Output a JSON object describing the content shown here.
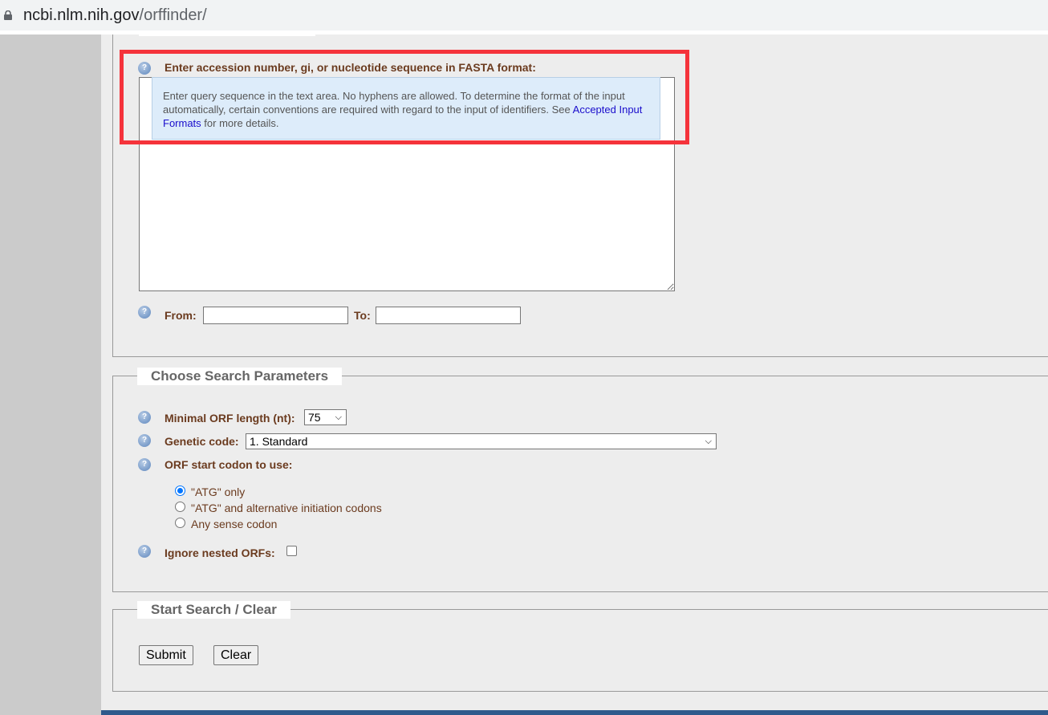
{
  "browser": {
    "url_host": "ncbi.nlm.nih.gov",
    "url_path": "/orffinder/"
  },
  "query": {
    "label": "Enter accession number, gi, or nucleotide sequence in FASTA format:",
    "tooltip_text": "Enter query sequence in the text area. No hyphens are allowed. To determine the format of the input automatically, certain conventions are required with regard to the input of identifiers. See ",
    "tooltip_link": "Accepted Input Formats",
    "tooltip_suffix": " for more details.",
    "sequence_value": "",
    "from_label": "From:",
    "from_value": "",
    "to_label": "To:",
    "to_value": ""
  },
  "params": {
    "legend": "Choose Search Parameters",
    "min_orf_label": "Minimal ORF length (nt):",
    "min_orf_value": "75",
    "genetic_code_label": "Genetic code:",
    "genetic_code_value": "1. Standard",
    "start_codon_label": "ORF start codon to use:",
    "start_codon_options": [
      "\"ATG\" only",
      "\"ATG\" and alternative initiation codons",
      "Any sense codon"
    ],
    "start_codon_selected": 0,
    "ignore_nested_label": "Ignore nested ORFs:",
    "ignore_nested_checked": false
  },
  "actions": {
    "legend": "Start Search / Clear",
    "submit": "Submit",
    "clear": "Clear"
  },
  "colors": {
    "highlight": "#f5333b",
    "label": "#6b3b1f",
    "tooltip_bg": "#ddecfa"
  }
}
